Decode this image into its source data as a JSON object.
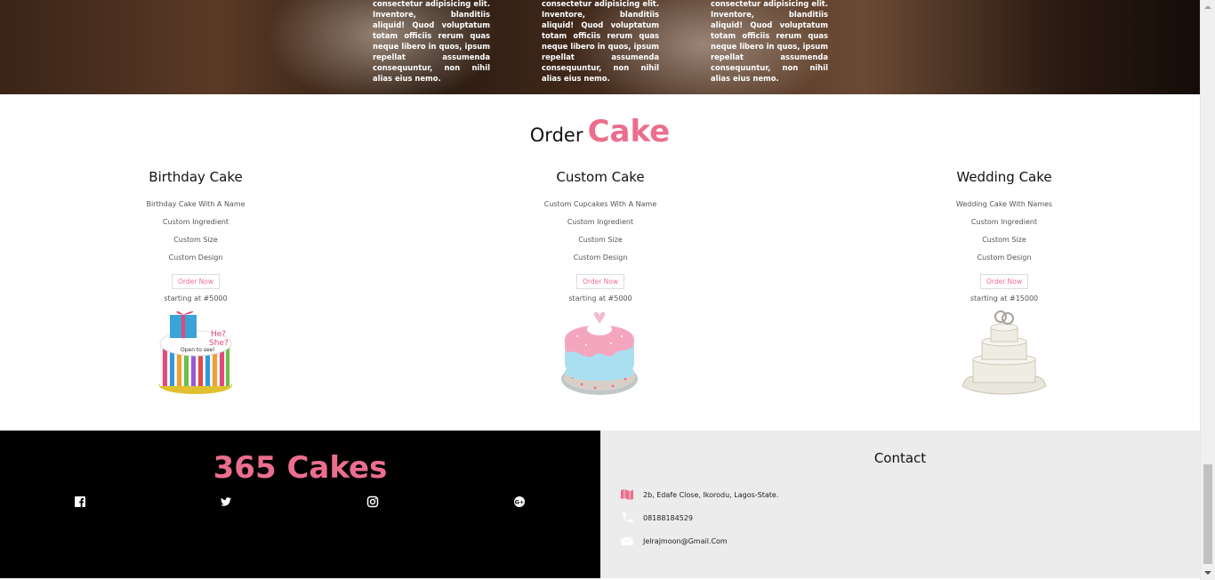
{
  "hero": {
    "columns": [
      {
        "text": "consectetur adipisicing elit. Inventore, blanditiis aliquid! Quod voluptatum totam officiis rerum quas neque libero in quos, ipsum repellat assumenda consequuntur, non nihil alias eius nemo."
      },
      {
        "text": "consectetur adipisicing elit. Inventore, blanditiis aliquid! Quod voluptatum totam officiis rerum quas neque libero in quos, ipsum repellat assumenda consequuntur, non nihil alias eius nemo."
      },
      {
        "text": "consectetur adipisicing elit. Inventore, blanditiis aliquid! Quod voluptatum totam officiis rerum quas neque libero in quos, ipsum repellat assumenda consequuntur, non nihil alias eius nemo."
      }
    ]
  },
  "order": {
    "title_part1": "Order",
    "title_part2": "Cake"
  },
  "cards": [
    {
      "title": "Birthday Cake",
      "features": [
        "Birthday Cake With A Name",
        "Custom Ingredient",
        "Custom Size",
        "Custom Design"
      ],
      "button": "Order Now",
      "price": "starting at #5000",
      "image": "birthday-cake-image"
    },
    {
      "title": "Custom Cake",
      "features": [
        "Custom Cupcakes With A Name",
        "Custom Ingredient",
        "Custom Size",
        "Custom Design"
      ],
      "button": "Order Now",
      "price": "starting at #5000",
      "image": "custom-cake-image"
    },
    {
      "title": "Wedding Cake",
      "features": [
        "Wedding Cake With Names",
        "Custom Ingredient",
        "Custom Size",
        "Custom Design"
      ],
      "button": "Order Now",
      "price": "starting at #15000",
      "image": "wedding-cake-image"
    }
  ],
  "footer": {
    "brand": "365 Cakes",
    "social": [
      "facebook-icon",
      "twitter-icon",
      "instagram-icon",
      "google-plus-icon"
    ],
    "contact_title": "Contact",
    "address": "2b, Edafe Close, Ikorodu, Lagos-State.",
    "phone": "08188184529",
    "email": "Jelrajmoon@Gmail.Com"
  },
  "colors": {
    "accent": "#ec6e8e",
    "footer_dark": "#000000",
    "footer_light": "#ececec"
  }
}
